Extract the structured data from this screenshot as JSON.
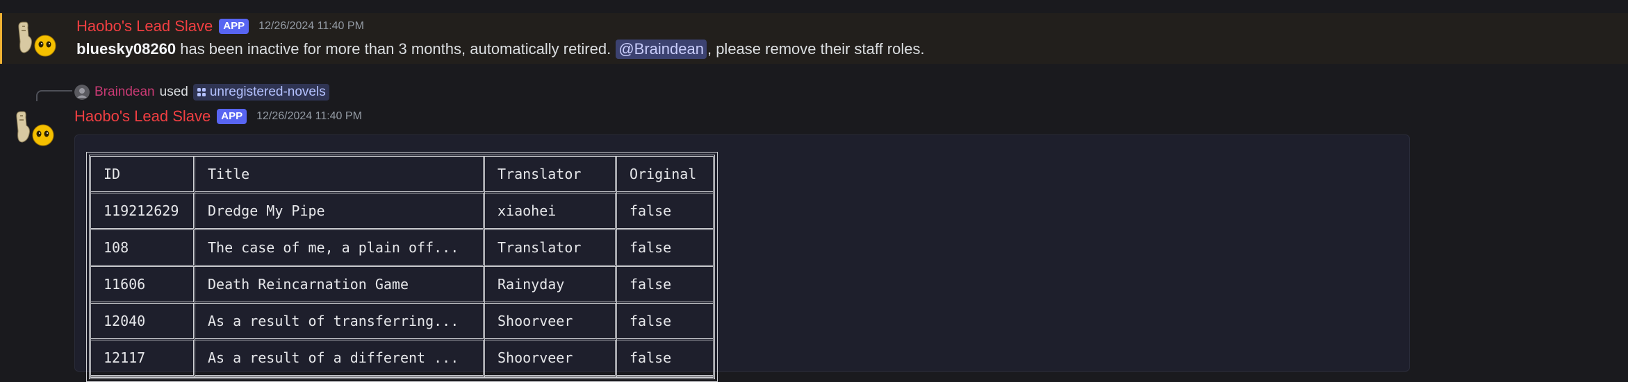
{
  "message1": {
    "username": "Haobo's Lead Slave",
    "badge": "APP",
    "timestamp": "12/26/2024 11:40 PM",
    "user_bold": "bluesky08260",
    "text_a": " has been inactive for more than 3 months, automatically retired. ",
    "mention": "@Braindean",
    "text_b": ", please remove their staff roles."
  },
  "reply": {
    "user": "Braindean",
    "used": "used",
    "command": "unregistered-novels"
  },
  "message2": {
    "username": "Haobo's Lead Slave",
    "badge": "APP",
    "timestamp": "12/26/2024 11:40 PM"
  },
  "table": {
    "headers": [
      "ID",
      "Title",
      "Translator",
      "Original"
    ],
    "rows": [
      [
        "119212629",
        "Dredge My Pipe",
        "xiaohei",
        "false"
      ],
      [
        "108",
        "The case of me, a plain off...",
        "Translator",
        "false"
      ],
      [
        "11606",
        "Death Reincarnation Game",
        "Rainyday",
        "false"
      ],
      [
        "12040",
        "As a result of transferring...",
        "Shoorveer",
        "false"
      ],
      [
        "12117",
        "As a result of a different ...",
        "Shoorveer",
        "false"
      ]
    ]
  },
  "colors": {
    "username": "#f23f42",
    "badge": "#5865f2",
    "highlight_border": "#f0b232",
    "reply_user": "#c93a74",
    "command_text": "#b4c1ff"
  },
  "icons": {
    "bot_avatar": "yellow-emoji-bot-avatar",
    "reply_avatar": "braindean-avatar",
    "command_icon": "slash-command-icon"
  }
}
